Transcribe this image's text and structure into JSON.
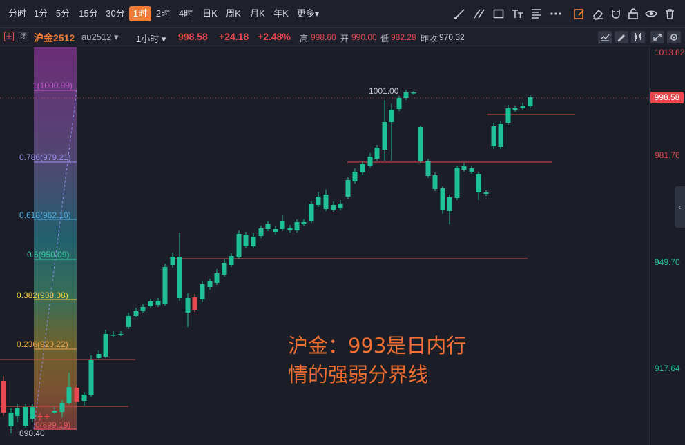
{
  "toolbar": {
    "timeframes": [
      "分时",
      "1分",
      "5分",
      "15分",
      "30分",
      "1时",
      "2时",
      "4时",
      "日K",
      "周K",
      "月K",
      "年K",
      "更多▾"
    ],
    "active_timeframe": "1时",
    "drawing_tools": [
      "trend-line-icon",
      "parallel-lines-icon",
      "rectangle-icon",
      "text-icon",
      "fibonacci-icon",
      "more-dots-icon"
    ],
    "right_tools": [
      "edit-icon",
      "eraser-icon",
      "magnet-icon",
      "lock-icon",
      "eye-icon",
      "trash-icon"
    ]
  },
  "info": {
    "badge_main": "主",
    "badge_closed": "闭",
    "instrument": "沪金2512",
    "contract": "au2512 ▾",
    "interval": "1小时 ▾",
    "last": "998.58",
    "change": "+24.18",
    "change_pct": "+2.48%",
    "high_label": "高",
    "high": "998.60",
    "open_label": "开",
    "open": "990.00",
    "low_label": "低",
    "low": "982.28",
    "prev_label": "昨收",
    "prev": "970.32"
  },
  "colors": {
    "up": "#e7484f",
    "down": "#1fbf97",
    "bg": "#1b1e27",
    "accent": "#f07c3a"
  },
  "axis": {
    "labels": [
      {
        "text": "1013.82",
        "color": "#e7484f"
      },
      {
        "text": "981.76",
        "color": "#e7484f"
      },
      {
        "text": "949.70",
        "color": "#1fbf97"
      },
      {
        "text": "917.64",
        "color": "#1fbf97"
      }
    ],
    "current": "998.58"
  },
  "fib": {
    "levels": [
      {
        "text": "1(1000.99)",
        "color": "#c25ac9"
      },
      {
        "text": "0.786(979.21)",
        "color": "#9a8fe8"
      },
      {
        "text": "0.618(962.10)",
        "color": "#4fb2e6"
      },
      {
        "text": "0.5(950.09)",
        "color": "#3ad0a6"
      },
      {
        "text": "0.382(938.08)",
        "color": "#f4d03f"
      },
      {
        "text": "0.236(923.22)",
        "color": "#f0a04a"
      },
      {
        "text": "0(899.19)",
        "color": "#e25b5b"
      }
    ]
  },
  "markers": {
    "high": "1001.00",
    "low": "898.40"
  },
  "annotation": {
    "line1": "沪金：993是日内行",
    "line2": "情的强弱分界线"
  }
}
